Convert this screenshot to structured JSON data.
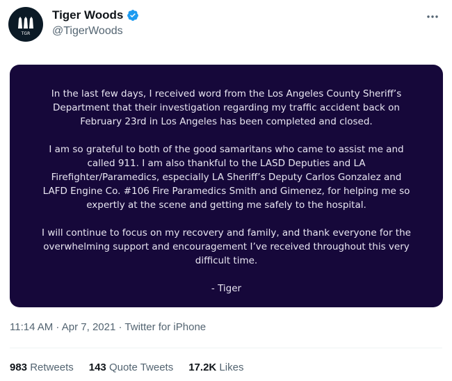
{
  "author": {
    "display_name": "Tiger Woods",
    "handle": "@TigerWoods",
    "avatar_text": "TGR",
    "verified": true
  },
  "statement": {
    "paragraphs": [
      "In the last few days, I received word from the Los Angeles County Sheriff’s Department that their investigation regarding my traffic accident back on February 23rd in Los Angeles has been completed and closed.",
      "I am so grateful to both of the good samaritans who came to assist me and called 911. I am also thankful to the LASD Deputies and LA Firefighter/Paramedics, especially LA Sheriff’s Deputy Carlos Gonzalez and LAFD Engine Co. #106 Fire Paramedics Smith and Gimenez, for helping me so expertly at the scene and getting me safely to the hospital.",
      "I will continue to focus on my recovery and family, and thank everyone for the overwhelming support and encouragement I’ve received throughout this very difficult time.",
      "- Tiger"
    ],
    "background": "#16083a"
  },
  "meta": {
    "time": "11:14 AM",
    "date": "Apr 7, 2021",
    "source": "Twitter for iPhone"
  },
  "stats": {
    "retweets_count": "983",
    "retweets_label": "Retweets",
    "quotes_count": "143",
    "quotes_label": "Quote Tweets",
    "likes_count": "17.2K",
    "likes_label": "Likes"
  },
  "icons": {
    "verified": "verified-badge-icon",
    "more": "more-horizontal-icon"
  }
}
